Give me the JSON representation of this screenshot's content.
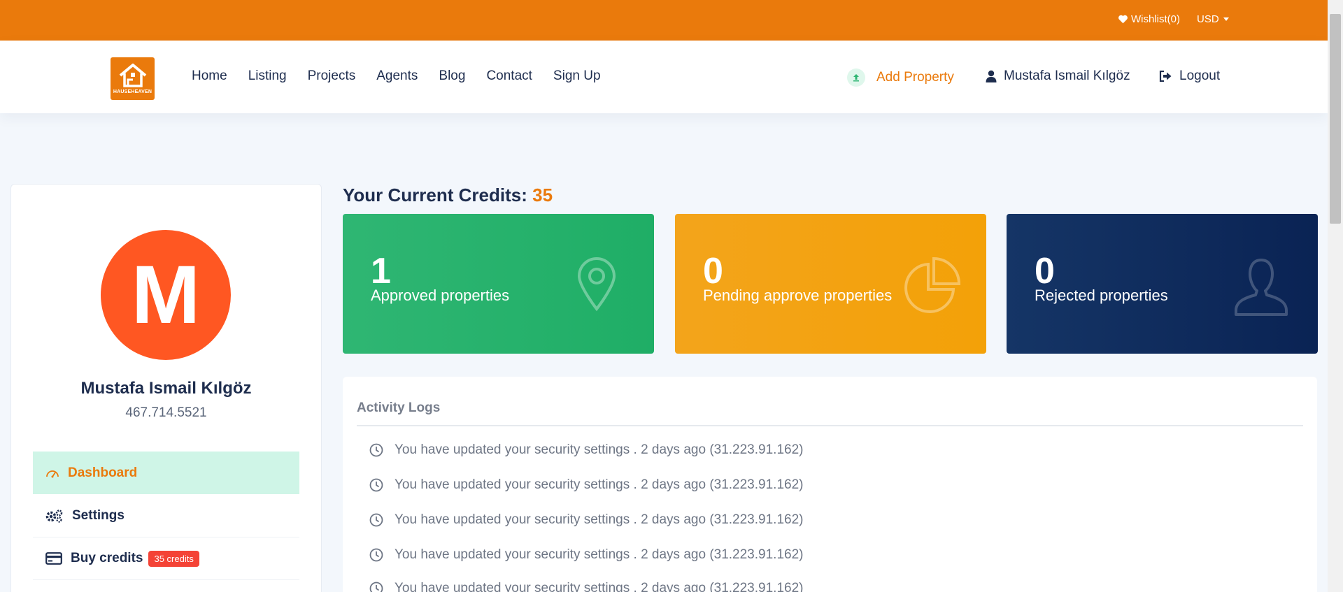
{
  "topbar": {
    "wishlist": "Wishlist(0)",
    "currency": "USD"
  },
  "logo": {
    "text": "HAUSEHEAVEN"
  },
  "nav": {
    "items": [
      "Home",
      "Listing",
      "Projects",
      "Agents",
      "Blog",
      "Contact",
      "Sign Up"
    ],
    "add_property": "Add Property",
    "user": "Mustafa Ismail Kılgöz",
    "logout": "Logout"
  },
  "profile": {
    "initial": "M",
    "name": "Mustafa Ismail Kılgöz",
    "phone": "467.714.5521"
  },
  "sidebar": {
    "items": [
      {
        "label": "Dashboard",
        "icon": "gauge-icon",
        "active": true
      },
      {
        "label": "Settings",
        "icon": "gears-icon"
      },
      {
        "label": "Buy credits",
        "icon": "credit-card-icon",
        "badge": "35 credits"
      }
    ]
  },
  "credits": {
    "title": "Your Current Credits:",
    "value": "35"
  },
  "cards": [
    {
      "count": "1",
      "label": "Approved properties",
      "icon": "map-pin-icon",
      "color": "#2fb673"
    },
    {
      "count": "0",
      "label": "Pending approve properties",
      "icon": "pie-chart-icon",
      "color": "#f3a41b"
    },
    {
      "count": "0",
      "label": "Rejected properties",
      "icon": "user-outline-icon",
      "color": "#0f2d5e"
    }
  ],
  "activity": {
    "title": "Activity Logs",
    "items": [
      "You have updated your security settings . 2 days ago (31.223.91.162)",
      "You have updated your security settings . 2 days ago (31.223.91.162)",
      "You have updated your security settings . 2 days ago (31.223.91.162)",
      "You have updated your security settings . 2 days ago (31.223.91.162)",
      "You have updated your security settings . 2 days ago (31.223.91.162)"
    ]
  }
}
